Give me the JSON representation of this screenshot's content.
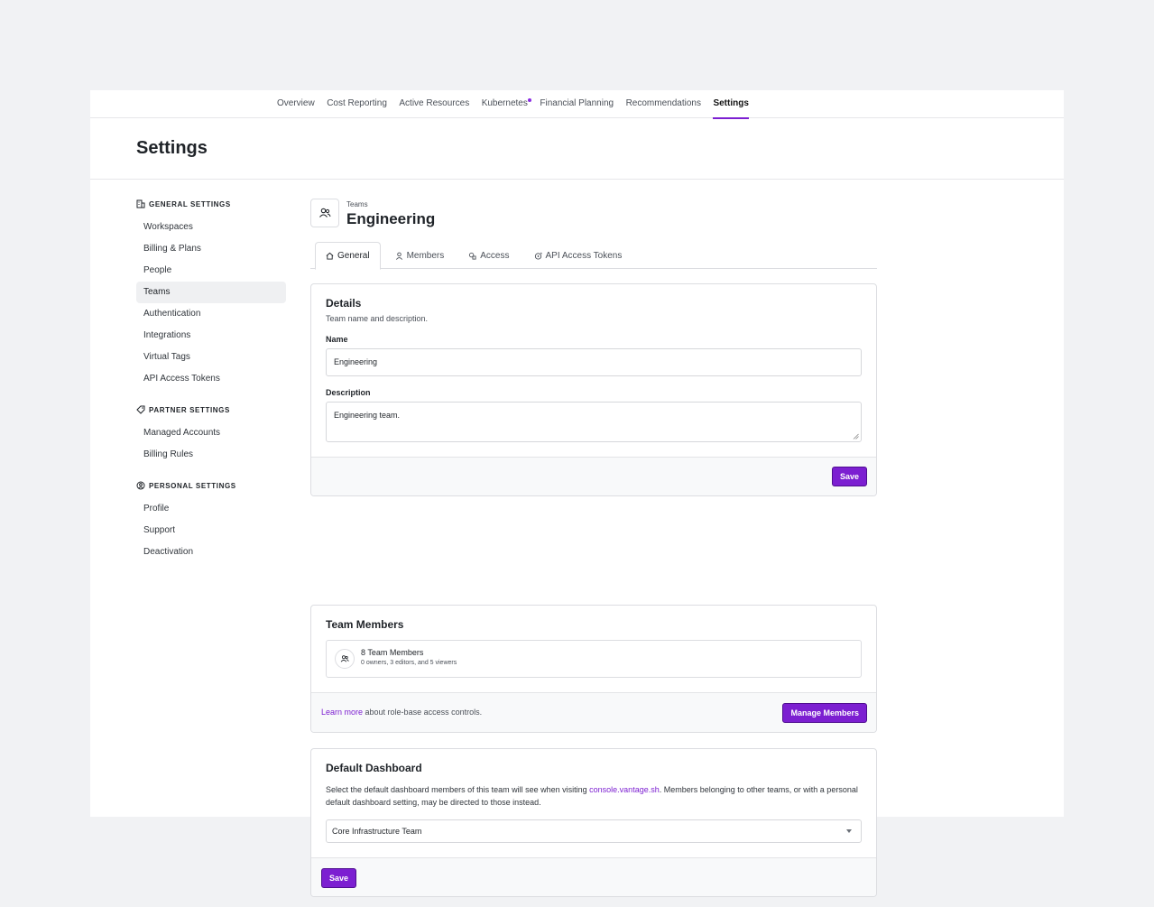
{
  "topnav": {
    "tabs": [
      {
        "label": "Overview"
      },
      {
        "label": "Cost Reporting"
      },
      {
        "label": "Active Resources"
      },
      {
        "label": "Kubernetes"
      },
      {
        "label": "Financial Planning"
      },
      {
        "label": "Recommendations"
      },
      {
        "label": "Settings"
      }
    ],
    "active": "Settings"
  },
  "page": {
    "title": "Settings"
  },
  "sidebar": {
    "general": {
      "heading": "GENERAL SETTINGS",
      "items": [
        "Workspaces",
        "Billing & Plans",
        "People",
        "Teams",
        "Authentication",
        "Integrations",
        "Virtual Tags",
        "API Access Tokens"
      ]
    },
    "partner": {
      "heading": "PARTNER SETTINGS",
      "items": [
        "Managed Accounts",
        "Billing Rules"
      ]
    },
    "personal": {
      "heading": "PERSONAL SETTINGS",
      "items": [
        "Profile",
        "Support",
        "Deactivation"
      ]
    },
    "active_item": "Teams"
  },
  "team": {
    "breadcrumb": "Teams",
    "name": "Engineering"
  },
  "subtabs": [
    "General",
    "Members",
    "Access",
    "API Access Tokens"
  ],
  "details": {
    "title": "Details",
    "subtitle": "Team name and description.",
    "name_label": "Name",
    "name_value": "Engineering",
    "description_label": "Description",
    "description_value": "Engineering team.",
    "save_label": "Save"
  },
  "members": {
    "title": "Team Members",
    "count_text": "8 Team Members",
    "breakdown": "0 owners, 3 editors, and 5 viewers",
    "learn_more": "Learn more",
    "footer_text": " about role-base access controls.",
    "manage_label": "Manage Members"
  },
  "dashboard": {
    "title": "Default Dashboard",
    "desc_before": "Select the default dashboard members of this team will see when visiting ",
    "desc_link": "console.vantage.sh",
    "desc_after": ". Members belonging to other teams, or with a personal default dashboard setting, may be directed to those instead.",
    "selected": "Core Infrastructure Team",
    "save_label": "Save"
  },
  "colors": {
    "accent": "#7c1fd1",
    "background": "#f1f2f4"
  }
}
